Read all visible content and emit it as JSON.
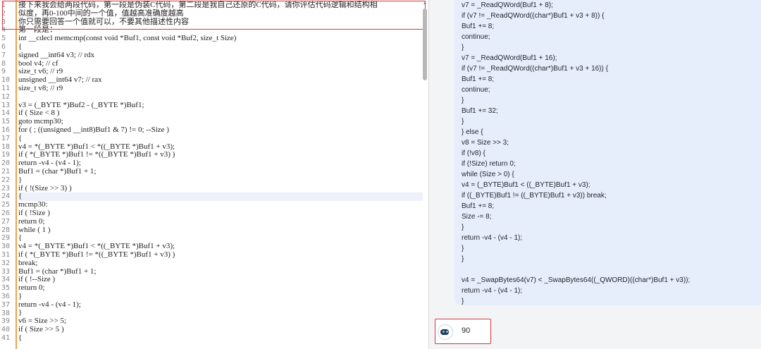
{
  "editor": {
    "line_numbers": [
      "1",
      "2",
      "3",
      "4",
      "5",
      "6",
      "7",
      "8",
      "9",
      "10",
      "11",
      "12",
      "13",
      "14",
      "15",
      "16",
      "17",
      "18",
      "19",
      "20",
      "21",
      "22",
      "23",
      "24",
      "25",
      "26",
      "27",
      "28",
      "29",
      "30",
      "31",
      "32",
      "33",
      "34",
      "35",
      "36",
      "37",
      "38",
      "39",
      "40",
      "41"
    ],
    "lines": [
      "接下来我会给两段代码，第一段是伪装C代码，第二段是我自己还原的C代码，请你评估代码逻辑和结构相",
      "似度，再0-100中间的一个值，值越高准确度越高",
      "你只需要回答一个值就可以，不要其他描述性内容",
      "第一段是：",
      "int __cdecl memcmp(const void *Buf1, const void *Buf2, size_t Size)",
      "{",
      "signed __int64 v3; // rdx",
      "bool v4; // cf",
      "size_t v6; // r9",
      "unsigned __int64 v7; // rax",
      "size_t v8; // r9",
      "",
      "v3 = (_BYTE *)Buf2 - (_BYTE *)Buf1;",
      "if ( Size < 8 )",
      "goto mcmp30;",
      "for ( ; ((unsigned __int8)Buf1 & 7) != 0; --Size )",
      "{",
      "v4 = *(_BYTE *)Buf1 < *((_BYTE *)Buf1 + v3);",
      "if ( *(_BYTE *)Buf1 != *((_BYTE *)Buf1 + v3) )",
      "return -v4 - (v4 - 1);",
      "Buf1 = (char *)Buf1 + 1;",
      "}",
      "if ( !(Size >> 3) )",
      "{",
      "mcmp30:",
      "if ( !Size )",
      "return 0;",
      "while ( 1 )",
      "{",
      "v4 = *(_BYTE *)Buf1 < *((_BYTE *)Buf1 + v3);",
      "if ( *(_BYTE *)Buf1 != *((_BYTE *)Buf1 + v3) )",
      "break;",
      "Buf1 = (char *)Buf1 + 1;",
      "if ( !--Size )",
      "return 0;",
      "}",
      "return -v4 - (v4 - 1);",
      "}",
      "v6 = Size >> 5;",
      "if ( Size >> 5 )",
      "{"
    ]
  },
  "chat": {
    "bubble_lines": [
      "v7 = _ReadQWord(Buf1 + 8);",
      "if (v7 != _ReadQWord((char*)Buf1 + v3 + 8)) {",
      "Buf1 += 8;",
      "continue;",
      "}",
      "v7 = _ReadQWord(Buf1 + 16);",
      "if (v7 != _ReadQWord((char*)Buf1 + v3 + 16)) {",
      "Buf1 += 8;",
      "continue;",
      "}",
      "Buf1 += 32;",
      "}",
      "} else {",
      "v8 = Size >> 3;",
      "if (!v8) {",
      "if (!Size) return 0;",
      "while (Size > 0) {",
      "v4 = (_BYTE)Buf1 < ((_BYTE)Buf1 + v3);",
      "if ((_BYTE)Buf1 != ((_BYTE)Buf1 + v3)) break;",
      "Buf1 += 8;",
      "Size -= 8;",
      "}",
      "return -v4 - (v4 - 1);",
      "}",
      "}",
      "",
      "v4 = _SwapBytes64(v7) < _SwapBytes64((_QWORD)((char*)Buf1 + v3));",
      "return -v4 - (v4 - 1);",
      "}"
    ],
    "reply_value": "90",
    "bot_icon": "robot-avatar-icon"
  },
  "colors": {
    "gutter_line": "#f0a04b",
    "highlight_box": "#d9363e",
    "bubble_bg": "#e7eefb"
  }
}
